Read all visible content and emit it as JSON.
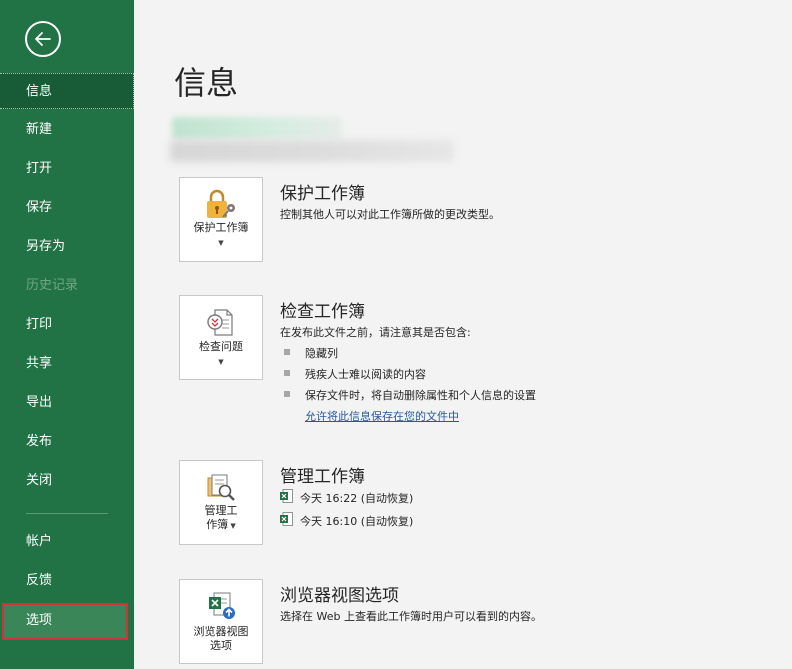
{
  "sidebar": {
    "items": [
      {
        "label": "信息"
      },
      {
        "label": "新建"
      },
      {
        "label": "打开"
      },
      {
        "label": "保存"
      },
      {
        "label": "另存为"
      },
      {
        "label": "历史记录"
      },
      {
        "label": "打印"
      },
      {
        "label": "共享"
      },
      {
        "label": "导出"
      },
      {
        "label": "发布"
      },
      {
        "label": "关闭"
      },
      {
        "label": "帐户"
      },
      {
        "label": "反馈"
      },
      {
        "label": "选项"
      }
    ]
  },
  "main": {
    "title": "信息",
    "protect": {
      "tile_label": "保护工作簿",
      "title": "保护工作簿",
      "desc": "控制其他人可以对此工作簿所做的更改类型。"
    },
    "inspect": {
      "tile_label": "检查问题",
      "title": "检查工作簿",
      "desc": "在发布此文件之前，请注意其是否包含:",
      "bullets": [
        "隐藏列",
        "残疾人士难以阅读的内容",
        "保存文件时，将自动删除属性和个人信息的设置"
      ],
      "link": "允许将此信息保存在您的文件中"
    },
    "manage": {
      "tile_label_1": "管理工",
      "tile_label_2": "作簿",
      "title": "管理工作簿",
      "versions": [
        "今天 16:22 (自动恢复)",
        "今天 16:10 (自动恢复)"
      ]
    },
    "browser": {
      "tile_label_1": "浏览器视图",
      "tile_label_2": "选项",
      "title": "浏览器视图选项",
      "desc": "选择在 Web 上查看此工作簿时用户可以看到的内容。"
    }
  },
  "colors": {
    "sidebar_bg": "#217346",
    "sidebar_active": "#185c37",
    "link": "#2b579a",
    "highlight_border": "#d13438"
  }
}
